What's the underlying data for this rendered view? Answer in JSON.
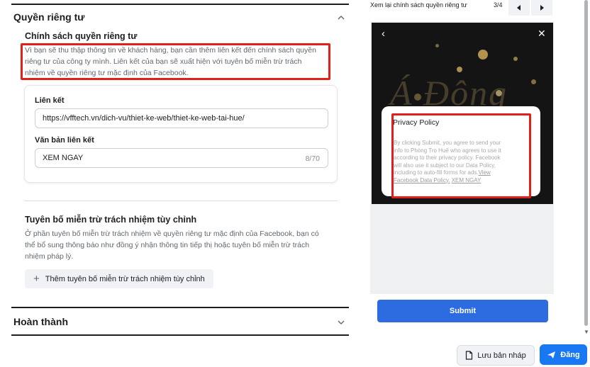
{
  "privacy_section": {
    "title": "Quyền riêng tư",
    "policy_title": "Chính sách quyền riêng tư",
    "policy_desc_lines": [
      "Vì bạn sẽ thu thập thông tin về khách hàng, bạn cần thêm liên kết đến chính sách quyền",
      "riêng tư của công ty mình. Liên kết của bạn sẽ xuất hiện với tuyên bố miễn trừ trách",
      "nhiệm về quyền riêng tư mặc định của Facebook."
    ],
    "link_label": "Liên kết",
    "link_value": "https://vfftech.vn/dich-vu/thiet-ke-web/thiet-ke-web-tai-hue/",
    "link_text_label": "Văn bản liên kết",
    "link_text_value": "XEM NGAY",
    "link_text_counter": "8/70",
    "disclaimer_title": "Tuyên bố miễn trừ trách nhiệm tùy chỉnh",
    "disclaimer_desc_lines": [
      "Ở phần tuyên bố miễn trừ trách nhiệm về quyền riêng tư mặc định của Facebook, bạn có",
      "thể bổ sung thông báo như đồng ý nhận thông tin tiếp thị hoặc tuyên bố miễn trừ trách",
      "nhiệm pháp lý."
    ],
    "add_disclaimer_label": "Thêm tuyên bố miễn trừ trách nhiệm tùy chỉnh"
  },
  "complete_section": {
    "title": "Hoàn thành"
  },
  "preview": {
    "header_label": "Xem lại chính sách quyền riêng tư",
    "page_indicator": "3/4",
    "hero_text": "Á Đông",
    "popup_title": "Privacy Policy",
    "popup_body_lines": [
      "By clicking Submit, you agree to send your",
      "info to Phòng Trọ Huế who agrees to use it",
      "according to their privacy policy. Facebook",
      "will also use it subject to our Data Policy,",
      "including to auto-fill forms for ads."
    ],
    "popup_link_1a": "View",
    "popup_link_1b": "Facebook Data Policy.",
    "popup_link_2": "XEM NGAY",
    "submit_label": "Submit"
  },
  "footer": {
    "draft_label": "Lưu bản nháp",
    "post_label": "Đăng"
  },
  "icons": {
    "chevron_up": "chevron-up-icon",
    "chevron_down": "chevron-down-icon",
    "prev": "chevron-left-icon",
    "next": "chevron-right-icon",
    "close": "close-icon",
    "plus": "plus-icon",
    "draft": "document-icon",
    "send": "send-icon"
  },
  "colors": {
    "highlight": "#e0201b",
    "submit": "#2d6ce0",
    "post": "#1877f2"
  }
}
